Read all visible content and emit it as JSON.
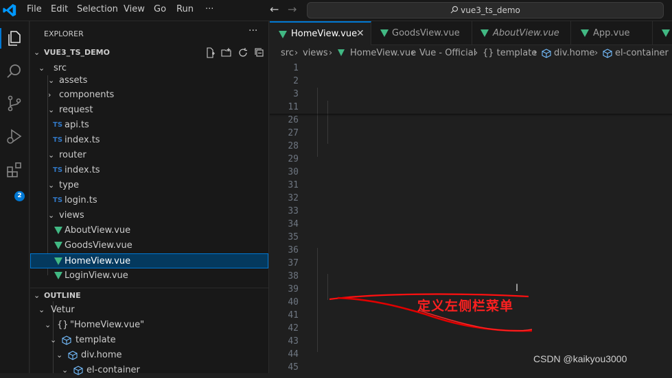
{
  "titlebar": {
    "menus": [
      "File",
      "Edit",
      "Selection",
      "View",
      "Go",
      "Run",
      "···"
    ],
    "search_text": "vue3_ts_demo"
  },
  "activity": {
    "extensions_badge": "2"
  },
  "sidebar": {
    "title": "EXPLORER",
    "more": "···",
    "workspace": "VUE3_TS_DEMO",
    "tree": [
      {
        "label": "src",
        "depth": 1,
        "kind": "folder-open"
      },
      {
        "label": "assets",
        "depth": 2,
        "kind": "folder-open"
      },
      {
        "label": "components",
        "depth": 2,
        "kind": "folder-closed"
      },
      {
        "label": "request",
        "depth": 2,
        "kind": "folder-open"
      },
      {
        "label": "api.ts",
        "depth": 3,
        "kind": "ts"
      },
      {
        "label": "index.ts",
        "depth": 3,
        "kind": "ts"
      },
      {
        "label": "router",
        "depth": 2,
        "kind": "folder-open"
      },
      {
        "label": "index.ts",
        "depth": 3,
        "kind": "ts"
      },
      {
        "label": "type",
        "depth": 2,
        "kind": "folder-open"
      },
      {
        "label": "login.ts",
        "depth": 3,
        "kind": "ts"
      },
      {
        "label": "views",
        "depth": 2,
        "kind": "folder-open"
      },
      {
        "label": "AboutView.vue",
        "depth": 3,
        "kind": "vue"
      },
      {
        "label": "GoodsView.vue",
        "depth": 3,
        "kind": "vue"
      },
      {
        "label": "HomeView.vue",
        "depth": 3,
        "kind": "vue",
        "selected": true
      },
      {
        "label": "LoginView.vue",
        "depth": 3,
        "kind": "vue"
      }
    ],
    "outline_title": "OUTLINE",
    "outline": [
      {
        "label": "Vetur",
        "depth": 1,
        "kind": "folder-open"
      },
      {
        "label": "\"HomeView.vue\"",
        "depth": 2,
        "kind": "braces"
      },
      {
        "label": "template",
        "depth": 3,
        "kind": "cube"
      },
      {
        "label": "div.home",
        "depth": 4,
        "kind": "cube"
      },
      {
        "label": "el-container",
        "depth": 5,
        "kind": "cube"
      }
    ]
  },
  "tabs": [
    {
      "label": "HomeView.vue",
      "active": true,
      "italic": false
    },
    {
      "label": "GoodsView.vue",
      "active": false,
      "italic": false
    },
    {
      "label": "AboutView.vue",
      "active": false,
      "italic": true
    },
    {
      "label": "App.vue",
      "active": false,
      "italic": false
    }
  ],
  "breadcrumb": {
    "items": [
      "src",
      "views",
      "HomeView.vue",
      "Vue - Official",
      "{} template",
      "div.home",
      "el-container"
    ]
  },
  "editor": {
    "line_numbers": [
      "1",
      "2",
      "3",
      "11",
      "26",
      "27",
      "28",
      "29",
      "30",
      "31",
      "32",
      "33",
      "34",
      "35",
      "36",
      "37",
      "38",
      "39",
      "40",
      "41",
      "42",
      "43",
      "44",
      "45"
    ]
  },
  "annotation": "定义左侧栏菜单",
  "watermark": "CSDN @kaikyou3000",
  "colors": {
    "accent": "#0078d4",
    "vue": "#41b883",
    "ts": "#3178c6",
    "annotation": "#ff2020"
  }
}
